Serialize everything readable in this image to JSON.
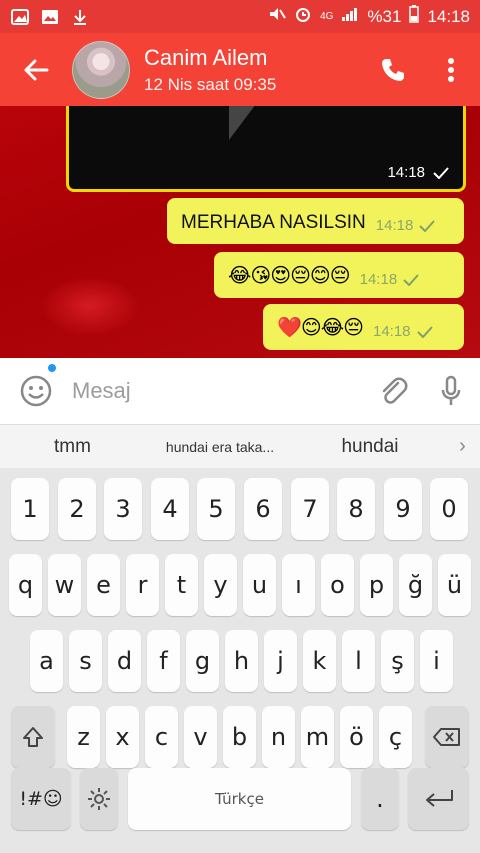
{
  "status": {
    "battery": "%31",
    "time": "14:18",
    "net": "4G"
  },
  "header": {
    "title": "Canim Ailem",
    "subtitle": "12 Nis saat 09:35"
  },
  "messages": [
    {
      "type": "media",
      "time": "14:18"
    },
    {
      "type": "text",
      "text": "MERHABA NASILSIN",
      "time": "14:18"
    },
    {
      "type": "emoji",
      "text": "😂😘😍😔😊😔",
      "time": "14:18"
    },
    {
      "type": "emoji",
      "text": "❤️😊😂😔",
      "time": "14:18"
    }
  ],
  "input": {
    "placeholder": "Mesaj"
  },
  "suggestions": [
    "tmm",
    "hundai era taka...",
    "hundai"
  ],
  "keyboard": {
    "numbers": [
      "1",
      "2",
      "3",
      "4",
      "5",
      "6",
      "7",
      "8",
      "9",
      "0"
    ],
    "row1": [
      "q",
      "w",
      "e",
      "r",
      "t",
      "y",
      "u",
      "ı",
      "o",
      "p",
      "ğ",
      "ü"
    ],
    "row2": [
      "a",
      "s",
      "d",
      "f",
      "g",
      "h",
      "j",
      "k",
      "l",
      "ş",
      "i"
    ],
    "row3": [
      "z",
      "x",
      "c",
      "v",
      "b",
      "n",
      "m",
      "ö",
      "ç"
    ],
    "symbols_label": "!#☺",
    "space_label": "Türkçe",
    "period": "."
  },
  "colors": {
    "header": "#f44336",
    "status": "#e53935",
    "chat_bg": "#b00308",
    "bubble": "#f2f25a"
  }
}
